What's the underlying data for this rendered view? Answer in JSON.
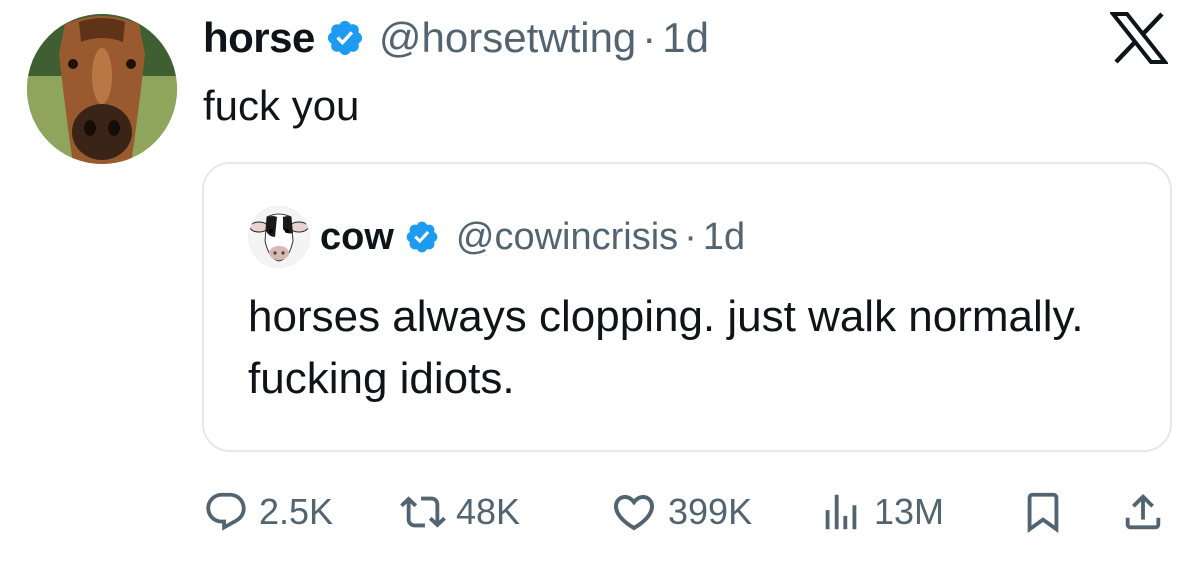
{
  "tweet": {
    "author": {
      "display_name": "horse",
      "handle": "@horsetwting",
      "verified": true,
      "avatar": "horse-face-photo"
    },
    "separator": "·",
    "time": "1d",
    "text": "fuck you"
  },
  "quoted_tweet": {
    "author": {
      "display_name": "cow",
      "handle": "@cowincrisis",
      "verified": true,
      "avatar": "cow-face-photo"
    },
    "separator": "·",
    "time": "1d",
    "text": "horses always clopping. just walk normally. fucking idiots."
  },
  "actions": {
    "replies": "2.5K",
    "reposts": "48K",
    "likes": "399K",
    "views": "13M",
    "bookmark_icon": "bookmark-icon",
    "share_icon": "share-icon"
  },
  "brand": {
    "logo": "x-logo",
    "verified_color": "#1d9bf0",
    "text_color": "#0f1419",
    "muted_color": "#536471"
  }
}
